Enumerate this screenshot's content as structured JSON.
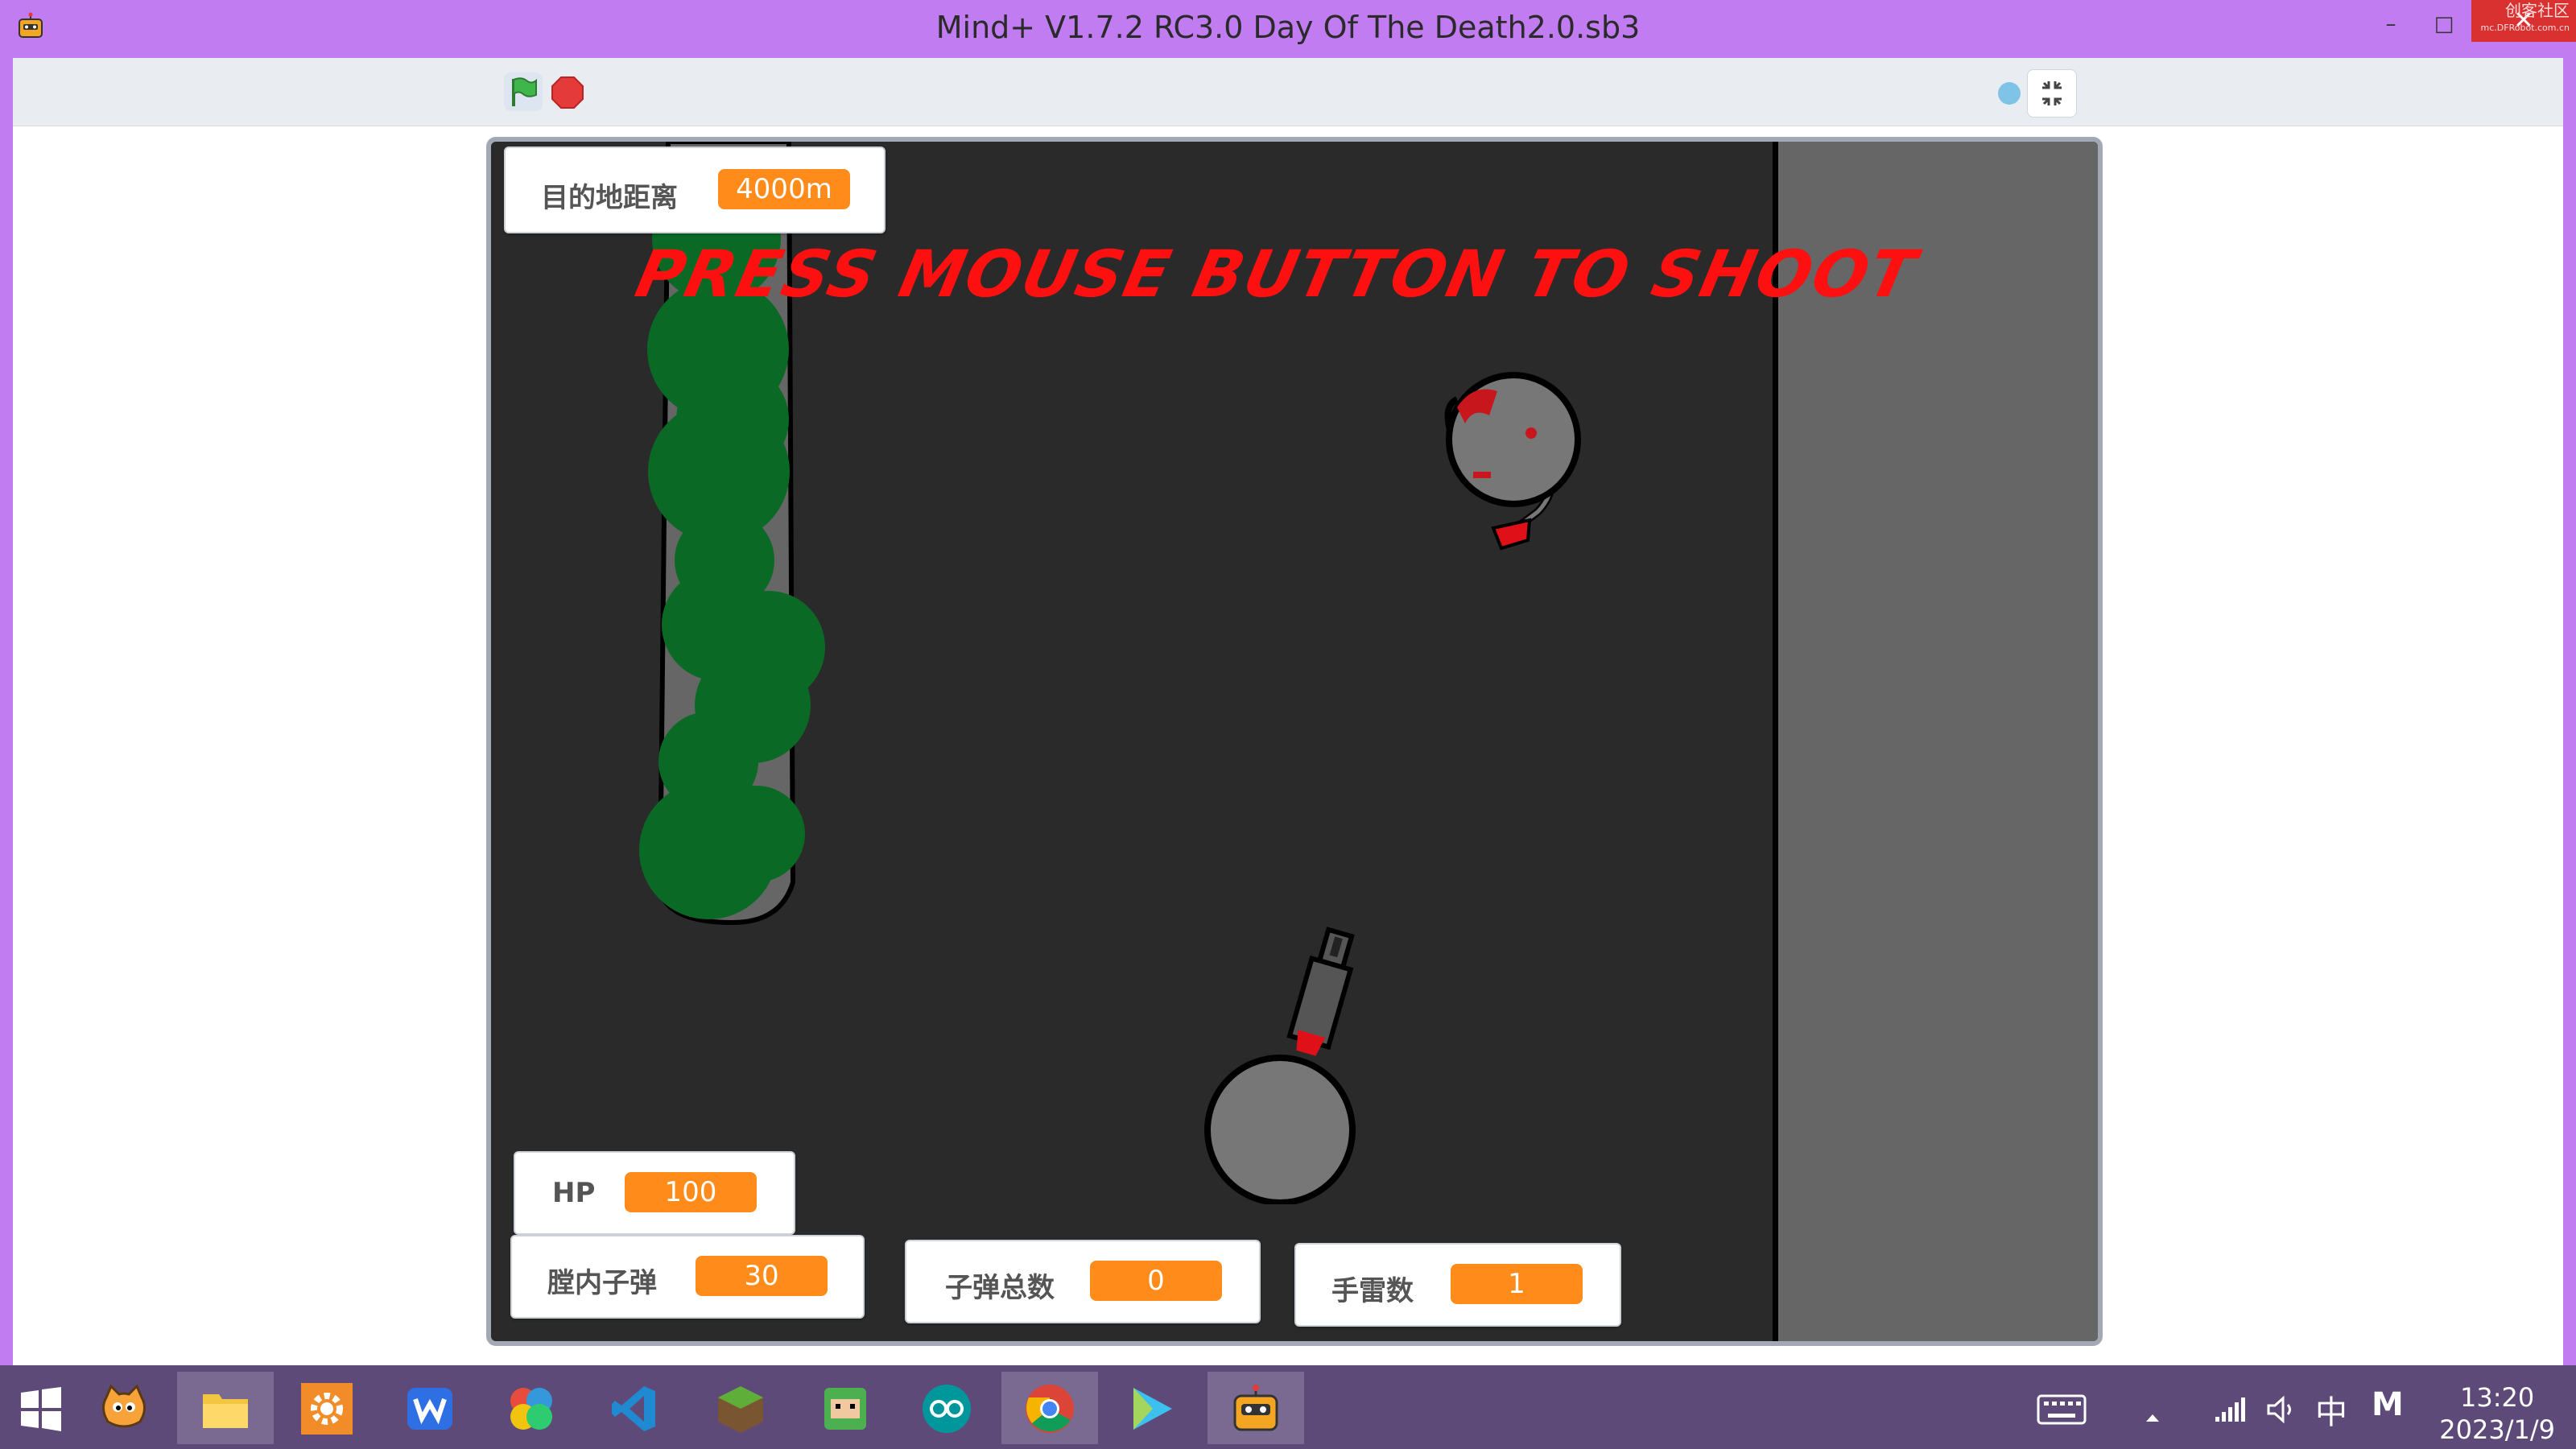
{
  "window": {
    "title": "Mind+ V1.7.2 RC3.0    Day Of The Death2.0.sb3",
    "minimize": "–",
    "maximize": "□",
    "close": "✕",
    "watermark_top": "创客社区",
    "watermark_bottom": "mc.DFRobot.com.cn"
  },
  "toolbar": {
    "green_flag_icon": "green-flag-icon",
    "stop_icon": "stop-sign-icon",
    "fullscreen_exit_icon": "collapse-icon",
    "accent_green": "#3fb64a",
    "stop_red": "#e53a3a"
  },
  "stage": {
    "instruction_text": "PRESS MOUSE BUTTON TO SHOOT",
    "text_color": "#ff1010",
    "road_color": "#2a2a2a",
    "sidewalk_color": "#666666",
    "tree_color": "#0a6a25"
  },
  "monitors": {
    "distance": {
      "label": "目的地距离",
      "value": "4000m"
    },
    "hp": {
      "label": "HP",
      "value": "100"
    },
    "chamber_ammo": {
      "label": "膛内子弹",
      "value": "30"
    },
    "total_ammo": {
      "label": "子弹总数",
      "value": "0"
    },
    "grenades": {
      "label": "手雷数",
      "value": "1"
    },
    "value_color": "#ff8c1a"
  },
  "taskbar": {
    "apps": [
      "start-icon",
      "scratch-cat-icon",
      "file-explorer-icon",
      "settings-gear-icon",
      "wps-icon",
      "colorful-clover-icon",
      "vscode-icon",
      "minecraft-icon",
      "game-character-icon",
      "arduino-icon",
      "chrome-icon",
      "media-player-icon",
      "mindplus-icon"
    ],
    "tray": {
      "keyboard_icon": "keyboard-icon",
      "arrow_icon": "tray-arrow-icon",
      "signal_icon": "signal-icon",
      "volume_icon": "volume-icon",
      "ime": "中",
      "ime_mode": "M"
    },
    "time": "13:20",
    "date": "2023/1/9"
  }
}
